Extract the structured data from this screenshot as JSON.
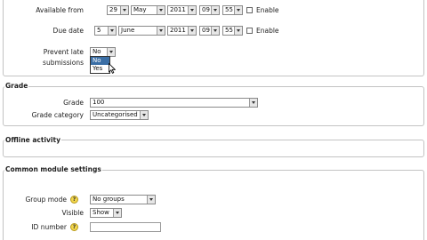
{
  "general": {
    "available_from": {
      "label": "Available from",
      "day": "29",
      "month": "May",
      "year": "2011",
      "hour": "09",
      "minute": "55",
      "enable_label": "Enable"
    },
    "due_date": {
      "label": "Due date",
      "day": "5",
      "month": "June",
      "year": "2011",
      "hour": "09",
      "minute": "55",
      "enable_label": "Enable"
    },
    "prevent_late": {
      "label_line1": "Prevent late",
      "label_line2": "submissions",
      "value": "No",
      "options": [
        "No",
        "Yes"
      ],
      "highlighted": "No"
    }
  },
  "grade_section": {
    "legend": "Grade",
    "grade_label": "Grade",
    "grade_value": "100",
    "category_label": "Grade category",
    "category_value": "Uncategorised"
  },
  "offline_section": {
    "legend": "Offline activity"
  },
  "common_section": {
    "legend": "Common module settings",
    "group_mode_label": "Group mode",
    "group_mode_value": "No groups",
    "visible_label": "Visible",
    "visible_value": "Show",
    "id_number_label": "ID number",
    "id_number_value": ""
  },
  "icons": {
    "help": "?"
  }
}
